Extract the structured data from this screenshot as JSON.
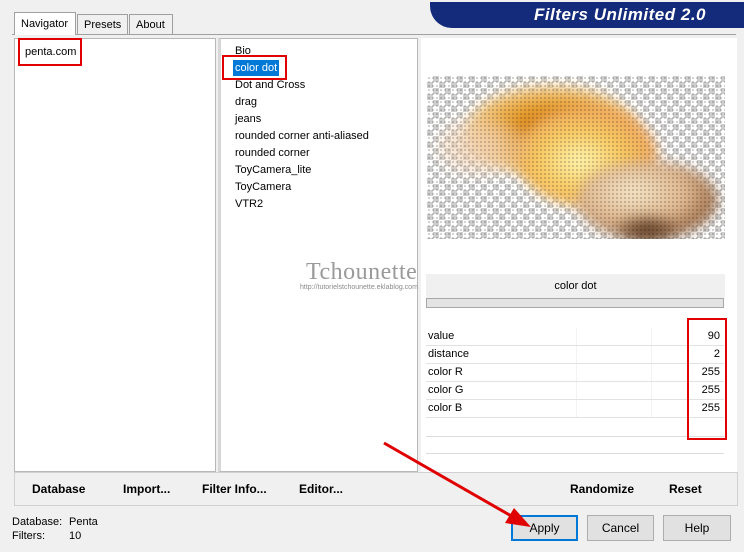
{
  "window": {
    "header_title": "Filters Unlimited 2.0"
  },
  "tabs": [
    {
      "label": "Navigator",
      "active": true
    },
    {
      "label": "Presets",
      "active": false
    },
    {
      "label": "About",
      "active": false
    }
  ],
  "navigator": {
    "items": [
      "penta.com"
    ],
    "selected": "penta.com"
  },
  "filters": {
    "items": [
      "Bio",
      "color dot",
      "Dot and Cross",
      "drag",
      "jeans",
      "rounded corner anti-aliased",
      "rounded corner",
      "ToyCamera_lite",
      "ToyCamera",
      "VTR2"
    ],
    "selected": "color dot"
  },
  "watermark": {
    "name": "Tchounette",
    "url": "http://tutorielstchounette.eklablog.com"
  },
  "filter_panel": {
    "title": "color dot",
    "params": [
      {
        "label": "value",
        "value": "90"
      },
      {
        "label": "distance",
        "value": "2"
      },
      {
        "label": "color R",
        "value": "255"
      },
      {
        "label": "color G",
        "value": "255"
      },
      {
        "label": "color B",
        "value": "255"
      }
    ]
  },
  "toolbar": {
    "database": "Database",
    "import": "Import...",
    "filter_info": "Filter Info...",
    "editor": "Editor...",
    "randomize": "Randomize",
    "reset": "Reset"
  },
  "status": {
    "database_label": "Database:",
    "database_value": "Penta",
    "filters_label": "Filters:",
    "filters_value": "10"
  },
  "buttons": {
    "apply": "Apply",
    "cancel": "Cancel",
    "help": "Help"
  },
  "colors": {
    "banner": "#142a7a",
    "selection": "#0078d7",
    "highlight": "#e00000"
  }
}
